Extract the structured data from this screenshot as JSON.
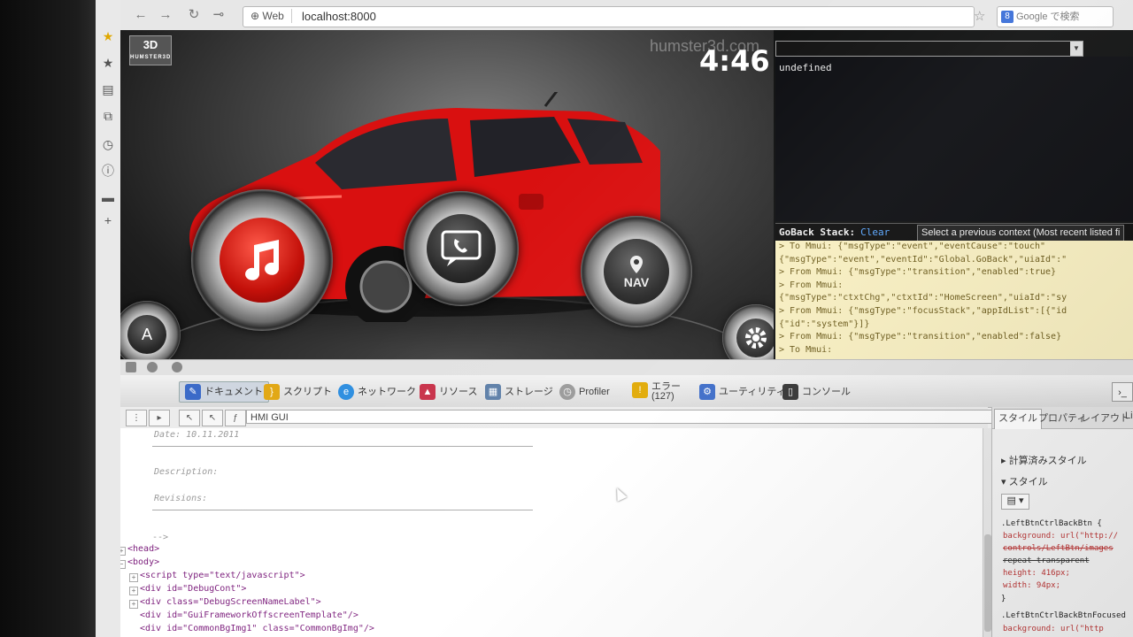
{
  "browser": {
    "web_chip": "Web",
    "url": "localhost:8000",
    "search_placeholder": "Google で検索",
    "search_engine_letter": "8"
  },
  "app": {
    "logo_main": "3D",
    "logo_sub": "HUMSTER3D",
    "watermark": "humster3d.com",
    "clock": "4:46",
    "buttons": [
      {
        "name": "music",
        "icon": "music-note-icon"
      },
      {
        "name": "phone",
        "icon": "phone-chat-icon"
      },
      {
        "name": "navigation",
        "label": "NAV",
        "icon": "map-pin-icon"
      },
      {
        "name": "apps",
        "label": "A"
      },
      {
        "name": "settings",
        "icon": "gear-icon"
      }
    ],
    "car_color": "#d91010"
  },
  "debug": {
    "output": "undefined",
    "goback_label": "GoBack Stack:",
    "clear_label": "Clear",
    "context_select": "Select a previous context (Most recent listed fi",
    "log_lines": [
      "> To Mmui: {\"msgType\":\"event\",\"eventCause\":\"touch\"",
      "{\"msgType\":\"event\",\"eventId\":\"Global.GoBack\",\"uiaId\":\"",
      "> From Mmui: {\"msgType\":\"transition\",\"enabled\":true}",
      "> From Mmui:",
      "{\"msgType\":\"ctxtChg\",\"ctxtId\":\"HomeScreen\",\"uiaId\":\"sy",
      "> From Mmui: {\"msgType\":\"focusStack\",\"appIdList\":[{\"id",
      "{\"id\":\"system\"}]}",
      "> From Mmui: {\"msgType\":\"transition\",\"enabled\":false}",
      "> To Mmui:"
    ]
  },
  "devtools": {
    "tabs": [
      {
        "label": "ドキュメント",
        "icon": "document-icon"
      },
      {
        "label": "スクリプト",
        "icon": "script-icon"
      },
      {
        "label": "ネットワーク",
        "icon": "network-icon"
      },
      {
        "label": "リソース",
        "icon": "resources-icon"
      },
      {
        "label": "ストレージ",
        "icon": "storage-icon"
      },
      {
        "label": "Profiler",
        "icon": "profiler-icon"
      },
      {
        "label": "エラー",
        "sub": "(127)",
        "icon": "error-icon"
      },
      {
        "label": "ユーティリティ",
        "icon": "utilities-icon"
      },
      {
        "label": "コンソール",
        "icon": "console-icon"
      }
    ],
    "frame_select": "HMI GUI",
    "code_comments": [
      "Date: 10.11.2011",
      "Description:",
      "Revisions:",
      "-->"
    ],
    "code_lines": [
      "<head>",
      "<body>",
      "<script type=\"text/javascript\">",
      "<div id=\"DebugCont\">",
      "<div class=\"DebugScreenNameLabel\">",
      "<div id=\"GuiFrameworkOffscreenTemplate\"/>",
      "<div id=\"CommonBgImg1\" class=\"CommonBgImg\"/>"
    ],
    "side_tabs": [
      "スタイル",
      "プロパティ",
      "レイアウト",
      "Li"
    ],
    "computed_style": "計算済みスタイル",
    "style_header": "スタイル",
    "css_lines": [
      ".LeftBtnCtrlBackBtn {",
      "background: url(\"http://",
      "controls/LeftBtn/images",
      "repeat transparent",
      "height: 416px;",
      "width: 94px;",
      "}",
      ".LeftBtnCtrlBackBtnFocused",
      "background: url(\"http"
    ]
  }
}
